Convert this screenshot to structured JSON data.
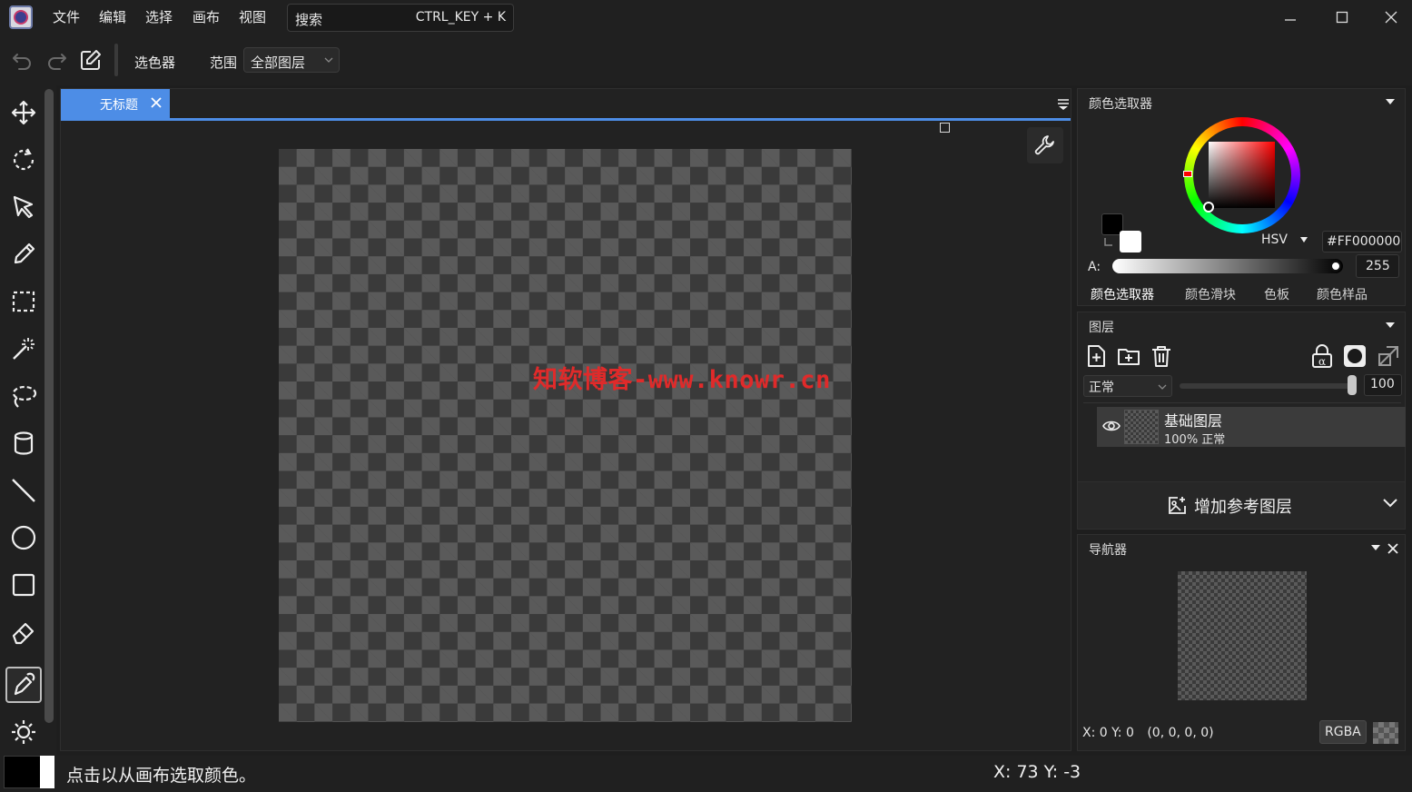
{
  "menu": {
    "file": "文件",
    "edit": "编辑",
    "select": "选择",
    "canvas": "画布",
    "view": "视图"
  },
  "search": {
    "label": "搜索",
    "shortcut": "CTRL_KEY + K"
  },
  "toolbar": {
    "tool_name": "选色器",
    "range_label": "范围",
    "range_value": "全部图层"
  },
  "document": {
    "tab_title": "无标题",
    "watermark": "知软博客-www.knowr.cn"
  },
  "color_panel": {
    "title": "颜色选取器",
    "mode": "HSV",
    "hex": "#FF000000",
    "alpha_label": "A:",
    "alpha_value": "255",
    "tabs": [
      "颜色选取器",
      "颜色滑块",
      "色板",
      "颜色样品"
    ],
    "active_tab": 0,
    "primary_color": "#000000",
    "secondary_color": "#ffffff"
  },
  "layers_panel": {
    "title": "图层",
    "blend_mode": "正常",
    "opacity": "100",
    "layers": [
      {
        "name": "基础图层",
        "meta": "100% 正常"
      }
    ],
    "add_reference": "增加参考图层"
  },
  "navigator": {
    "title": "导航器",
    "coords": "X: 0 Y: 0",
    "rgba_value": "(0, 0, 0, 0)",
    "rgba_button": "RGBA"
  },
  "status": {
    "hint": "点击以从画布选取颜色。",
    "cursor": "X: 73 Y: -3"
  },
  "colors": {
    "accent": "#4d8de6",
    "watermark": "#e02a2a"
  }
}
